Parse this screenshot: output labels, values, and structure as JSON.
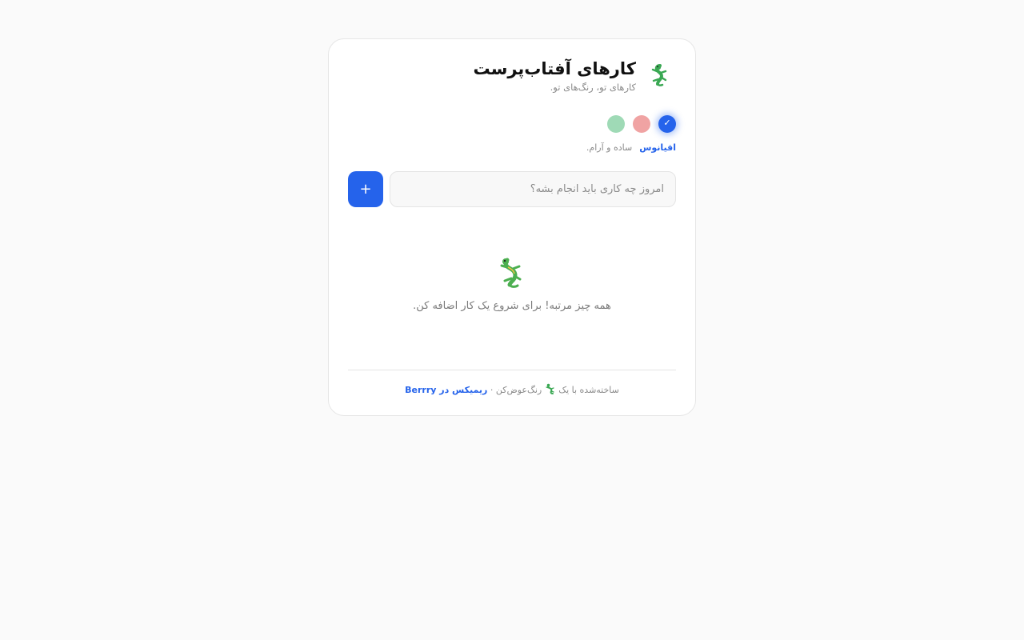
{
  "app": {
    "title": "کارهای آفتاب‌پرست",
    "subtitle": "کارهای تو، رنگ‌های تو.",
    "logo_icon": "lizard-icon"
  },
  "themes": {
    "selected": "ocean",
    "options": [
      {
        "id": "ocean",
        "color": "#2563eb",
        "selected": true
      },
      {
        "id": "rose",
        "color": "#f0a3a3",
        "selected": false
      },
      {
        "id": "mint",
        "color": "#9fdab6",
        "selected": false
      }
    ],
    "selected_name": "اقیانوس",
    "selected_desc": "ساده و آرام.",
    "check_glyph": "✓"
  },
  "task_input": {
    "placeholder": "امروز چه کاری باید انجام بشه؟",
    "value": ""
  },
  "add_button": {
    "label": "+"
  },
  "empty_state": {
    "icon": "lizard-icon",
    "message": "همه چیز مرتبه! برای شروع یک کار اضافه کن."
  },
  "footer": {
    "prefix": "ساخته‌شده با یک",
    "icon": "lizard-icon",
    "suffix": "رنگ‌عوض‌کن ·",
    "link_label": "ریمیکس در Berrry"
  },
  "colors": {
    "accent": "#2563eb",
    "background": "#fafafa",
    "card": "#ffffff"
  }
}
